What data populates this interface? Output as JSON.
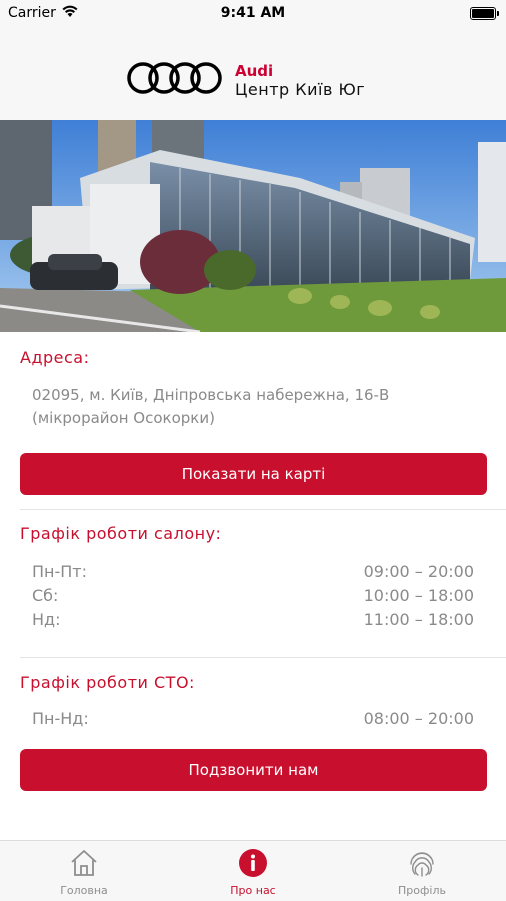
{
  "status_bar": {
    "carrier": "Carrier",
    "time": "9:41 AM"
  },
  "header": {
    "brand": "Audi",
    "dealer": "Центр Київ Юг"
  },
  "colors": {
    "accent": "#c8102e",
    "text_muted": "#8a8a8a",
    "header_bg": "#f7f7f7"
  },
  "address": {
    "title": "Адреса:",
    "line1": "02095, м. Київ, Дніпровська набережна, 16-В",
    "line2": "(мікрорайон Осокорки)",
    "map_button": "Показати на карті"
  },
  "showroom_hours": {
    "title": "Графік роботи салону:",
    "rows": [
      {
        "day": "Пн-Пт:",
        "hours": "09:00 – 20:00"
      },
      {
        "day": "Сб:",
        "hours": "10:00 – 18:00"
      },
      {
        "day": "Нд:",
        "hours": "11:00 – 18:00"
      }
    ]
  },
  "service_hours": {
    "title": "Графік роботи СТО:",
    "rows": [
      {
        "day": "Пн-Нд:",
        "hours": "08:00 – 20:00"
      }
    ],
    "call_button": "Подзвонити нам"
  },
  "tabs": [
    {
      "label": "Головна",
      "icon": "home-icon"
    },
    {
      "label": "Про нас",
      "icon": "info-icon",
      "active": true
    },
    {
      "label": "Профіль",
      "icon": "fingerprint-icon"
    }
  ]
}
